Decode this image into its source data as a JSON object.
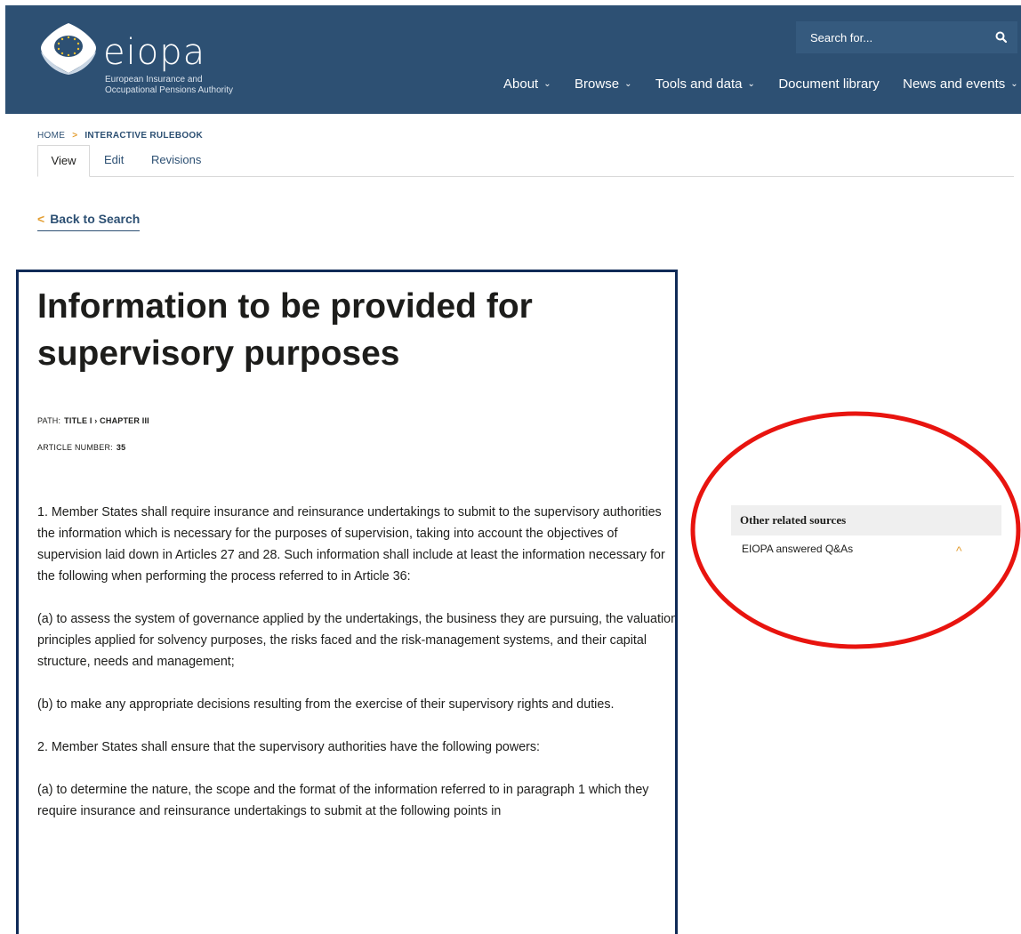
{
  "header": {
    "logo_name": "eiopa",
    "logo_subtitle_line1": "European Insurance and",
    "logo_subtitle_line2": "Occupational Pensions Authority",
    "search_placeholder": "Search for...",
    "nav": [
      {
        "label": "About",
        "has_dropdown": true
      },
      {
        "label": "Browse",
        "has_dropdown": true
      },
      {
        "label": "Tools and data",
        "has_dropdown": true
      },
      {
        "label": "Document library",
        "has_dropdown": false
      },
      {
        "label": "News and events",
        "has_dropdown": true
      }
    ],
    "chevron": "⌄"
  },
  "breadcrumb": {
    "home": "HOME",
    "separator": ">",
    "current": "INTERACTIVE RULEBOOK"
  },
  "tabs": [
    {
      "label": "View",
      "active": true
    },
    {
      "label": "Edit",
      "active": false
    },
    {
      "label": "Revisions",
      "active": false
    }
  ],
  "back_link": {
    "icon": "chevron-left-icon",
    "glyph": "<",
    "label": "Back to Search"
  },
  "article": {
    "title": "Information to be provided for supervisory purposes",
    "path_label": "PATH:",
    "path_value": "TITLE I › CHAPTER III",
    "article_number_label": "ARTICLE NUMBER:",
    "article_number_value": "35",
    "paragraphs": [
      "1.  Member States shall require insurance and reinsurance undertakings to submit to the supervisory authorities the information which is necessary for the purposes of supervision, taking into account the objectives of supervision laid down in Articles 27 and 28. Such information shall include at least the information necessary for the following when performing the process referred to in Article 36:",
      "(a) to assess the system of governance applied by the undertakings, the business they are pursuing, the valuation principles applied for solvency purposes, the risks faced and the risk-management systems, and their capital structure, needs and management;",
      "(b) to make any appropriate decisions resulting from the exercise of their supervisory rights and duties.",
      "2.  Member States shall ensure that the supervisory authorities have the following powers:",
      "(a) to determine the nature, the scope and the format of the information referred to in paragraph 1 which they require insurance and reinsurance undertakings to submit at the following points in"
    ]
  },
  "sidebar": {
    "heading": "Other related sources",
    "items": [
      {
        "label": "EIOPA answered Q&As",
        "icon": "chevron-up-icon",
        "glyph": "^"
      }
    ]
  },
  "colors": {
    "header_bg": "#2d5073",
    "accent_orange": "#e39e32",
    "article_border": "#0f2a57",
    "annotation_red": "#e8140f"
  }
}
